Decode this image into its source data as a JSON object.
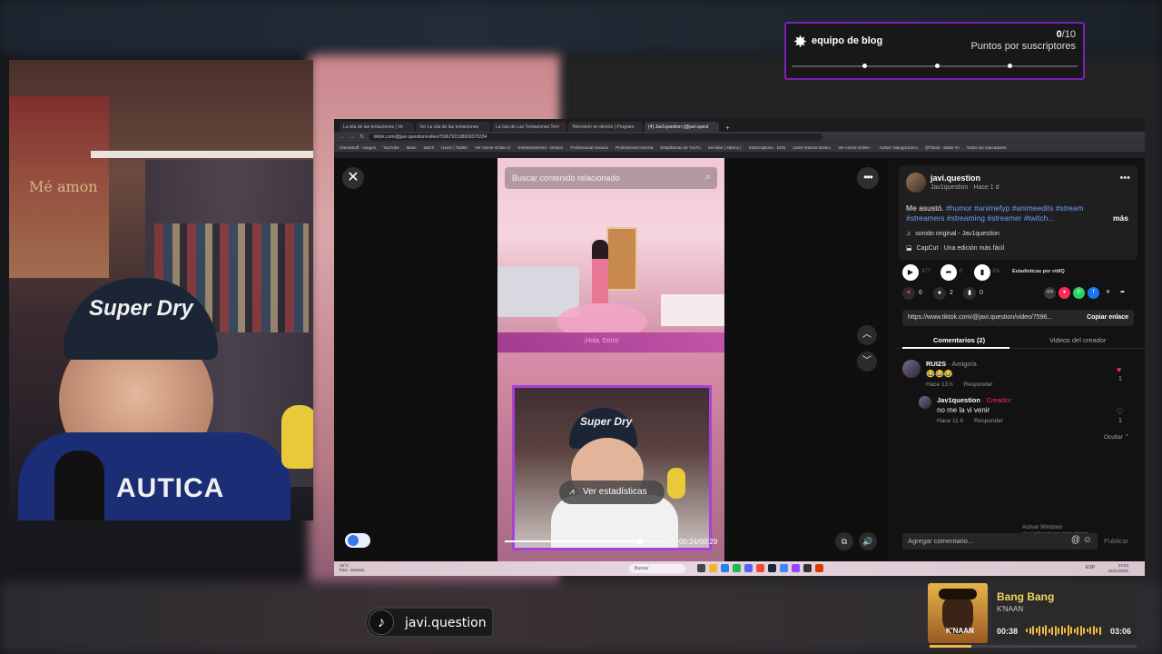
{
  "goal": {
    "label": "equipo de blog",
    "count_current": "0",
    "count_total": "/10",
    "subtitle": "Puntos por suscriptores",
    "icon": "star-burst-icon",
    "accent": "#7a1fb8"
  },
  "webcam": {
    "cap_text": "Super Dry",
    "shirt_text": "AUTICA",
    "poster_text": "Mé  amon"
  },
  "browser": {
    "tabs": [
      "La isla de las tentaciones | Ve",
      "Ver La isla de las tentaciones",
      "La Isla de Las Tentaciones Tem",
      "Televisión en directo | Program",
      "(4) Jav1question (@javi.quest"
    ],
    "url": "tiktok.com/@javi.question/video/7596791538609376334",
    "bookmarks": [
      "GameStuff - Juegos",
      "YouTube",
      "Maxe",
      "twitch",
      "Hacer | Twitter",
      "Ver Anime Online G",
      "Entretenimiento - Descar",
      "Professional Associa",
      "Professional Associa",
      "Estadísticas de YouTu",
      "Servidor | Alterno |",
      "Subscriptions - DAN",
      "Javier Ramos Botero",
      "Ver Anime Online -",
      "Cultos: Manga/Jueco",
      "@Tiktok - Make Yo",
      "Todos los marcadores"
    ]
  },
  "player": {
    "search_placeholder": "Buscar contenido relacionado",
    "game_label": "¡Hola, Doris!",
    "stats_button": "Ver estadísticas",
    "time": "00:24/00:29",
    "progress": 0.83,
    "cap_text": "Super Dry"
  },
  "post": {
    "username": "javi.question",
    "handle": "Jav1question · Hace 1 d",
    "desc_plain": "Me asustó. ",
    "hashtags_line1": "#humor #animefyp #animeedits #stream",
    "hashtags_line2": "#streamers #streaming #streamer #twitch...",
    "more": "más",
    "sound": "sonido original - Jav1question",
    "capcut": "CapCut · Una edición más fácil",
    "vidiq": "Estadísticas por vidIQ",
    "views": "377",
    "shares_count": "0",
    "eng": "2%",
    "likes": "6",
    "comments": "2",
    "saves": "0",
    "link": "https://www.tiktok.com/@javi.question/video/7596...",
    "copy_link": "Copiar enlace"
  },
  "comments_tabs": {
    "comments": "Comentarios (2)",
    "creator_videos": "Videos del creador"
  },
  "comments": [
    {
      "name": "RUI2S",
      "tag": " · Amigo/a",
      "text": "😂😂😂",
      "time": "Hace 13 h",
      "reply": "Responder",
      "likes": "1"
    },
    {
      "name": "Jav1question",
      "tag": " · Creador",
      "text": "no me la vi venir",
      "time": "Hace 11 h",
      "reply": "Responder",
      "likes": "1"
    }
  ],
  "ocultar": "Ocultar ⌃",
  "add_comment": "Agregar comentario...",
  "publish": "Publicar",
  "windows_activate": "Activar Windows",
  "windows_activate_sub": "Ve a Configuración para activar Windows.",
  "taskbar": {
    "weather": "19°C",
    "weather_sub": "Parc. soleado",
    "search": "Buscar",
    "clock_time": "23:03",
    "clock_date": "18/01/2026",
    "sys": "ESP"
  },
  "tiktok_badge": {
    "handle": "javi.question"
  },
  "music": {
    "title": "Bang Bang",
    "artist": "K'NAAN",
    "elapsed": "00:38",
    "total": "03:06",
    "progress": 0.2,
    "cover_text": "K'NAAN",
    "accent": "#f4b942"
  }
}
